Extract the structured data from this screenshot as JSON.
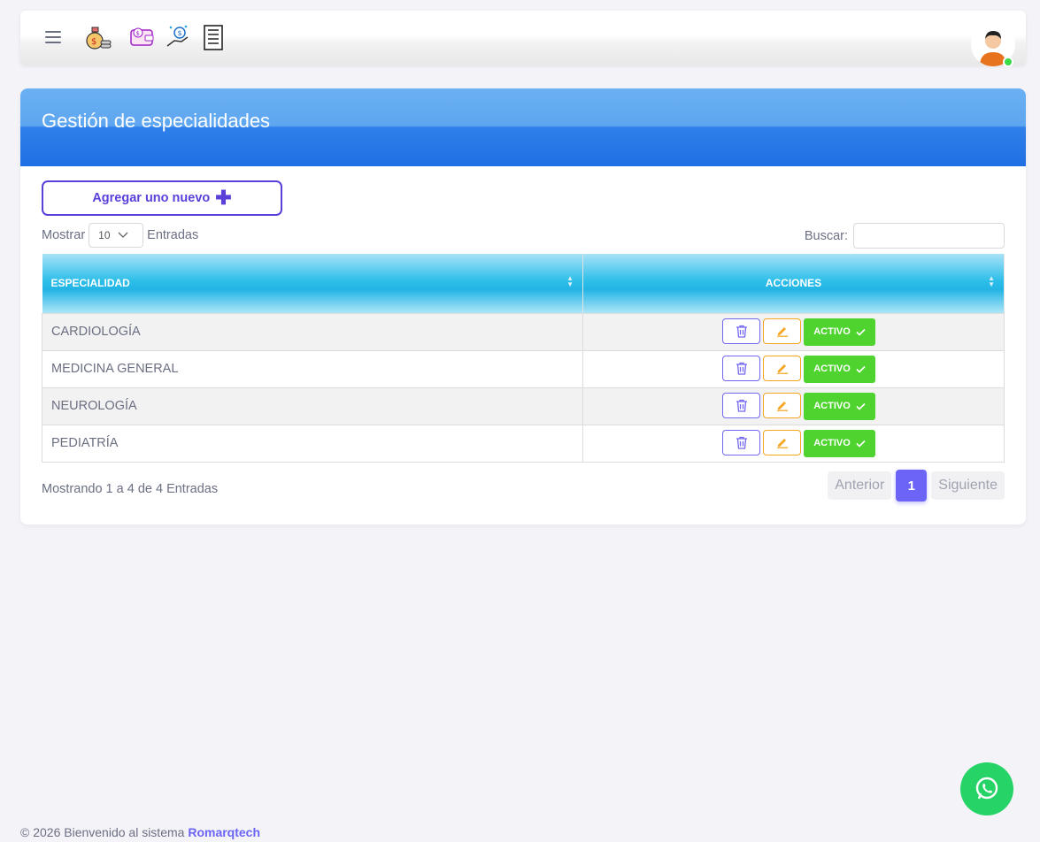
{
  "topbar": {
    "icons": [
      "money-bag-icon",
      "wallet-icon",
      "payment-hand-icon",
      "calculator-list-icon"
    ]
  },
  "card": {
    "title": "Gestión de especialidades",
    "add_button": "Agregar uno nuevo",
    "length": {
      "prefix": "Mostrar",
      "value": "10",
      "suffix": "Entradas"
    },
    "search_label": "Buscar:",
    "columns": [
      "ESPECIALIDAD",
      "ACCIONES"
    ],
    "rows": [
      {
        "name": "CARDIOLOGÍA",
        "status": "ACTIVO"
      },
      {
        "name": "MEDICINA GENERAL",
        "status": "ACTIVO"
      },
      {
        "name": "NEUROLOGÍA",
        "status": "ACTIVO"
      },
      {
        "name": "PEDIATRÍA",
        "status": "ACTIVO"
      }
    ],
    "info": "Mostrando 1 a 4 de 4 Entradas",
    "pager": {
      "prev": "Anterior",
      "current": "1",
      "next": "Siguiente"
    }
  },
  "footer": {
    "text": "© 2026 Bienvenido al sistema ",
    "brand": "Romarqtech"
  },
  "colors": {
    "primary": "#6b64f7",
    "header_blue": "#1f6fe3",
    "status_green": "#4fd32f",
    "whatsapp": "#25d366"
  }
}
